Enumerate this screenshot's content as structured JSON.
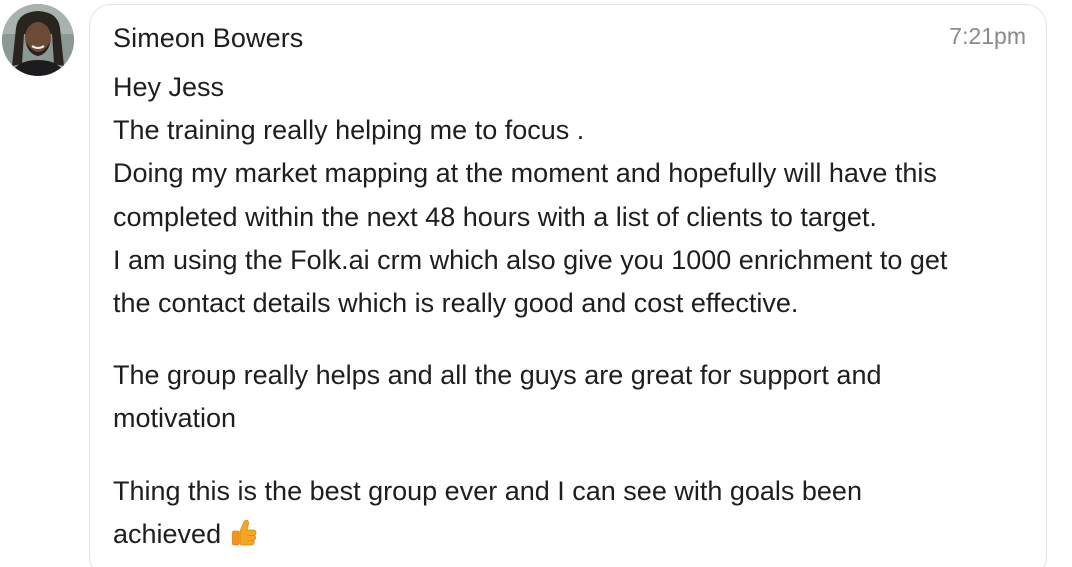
{
  "message": {
    "sender": "Simeon Bowers",
    "time": "7:21pm",
    "paragraphs": [
      {
        "lines": [
          "Hey Jess",
          "The training really helping me to focus .",
          "Doing my market mapping at the moment and hopefully will have this",
          "completed within the next 48 hours with a list of clients to target.",
          "I am using the Folk.ai crm which also give you 1000 enrichment to get",
          "the contact details which is really good and cost effective."
        ]
      },
      {
        "lines": [
          "The group really helps and all the guys are great for support and",
          "motivation"
        ]
      },
      {
        "lines": [
          "Thing this is the best group ever and I can see with goals been",
          "achieved"
        ]
      }
    ],
    "reaction_emoji": "thumbs-up-icon"
  },
  "colors": {
    "text": "#1e1e1e",
    "time": "#8a8a8a",
    "bubble_border": "#e3e3e3",
    "thumbs_up": "#f5a623"
  }
}
